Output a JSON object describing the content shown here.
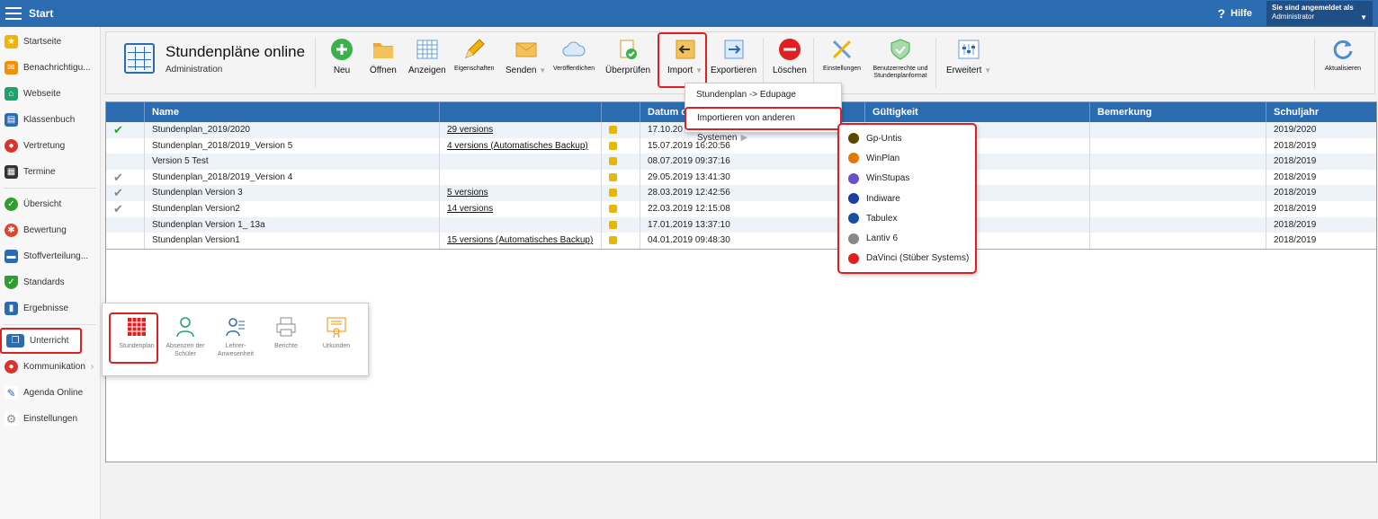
{
  "topbar": {
    "start_label": "Start",
    "help_label": "Hilfe",
    "help_icon": "?",
    "user_line1": "Sie sind angemeldet als",
    "user_line2": "Administrator"
  },
  "sidebar": {
    "items": [
      {
        "label": "Startseite",
        "icon": "star-icon",
        "color": "#f2b400"
      },
      {
        "label": "Benachrichtigu...",
        "icon": "envelope-icon",
        "color": "#f29000"
      },
      {
        "label": "Webseite",
        "icon": "home-icon",
        "color": "#1aa36b"
      },
      {
        "label": "Klassenbuch",
        "icon": "book-icon",
        "color": "#2b6cb0"
      },
      {
        "label": "Vertretung",
        "icon": "person-icon",
        "color": "#d9342b"
      },
      {
        "label": "Termine",
        "icon": "calendar-icon",
        "color": "#333333"
      },
      {
        "label": "Übersicht",
        "icon": "check-circle-icon",
        "color": "#2e9e2e"
      },
      {
        "label": "Bewertung",
        "icon": "rating-icon",
        "color": "#e0452b"
      },
      {
        "label": "Stoffverteilung...",
        "icon": "plan-icon",
        "color": "#2b6cb0"
      },
      {
        "label": "Standards",
        "icon": "shield-icon",
        "color": "#2e9e2e"
      },
      {
        "label": "Ergebnisse",
        "icon": "bar-chart-icon",
        "color": "#2b6cb0"
      },
      {
        "label": "Unterricht",
        "icon": "open-book-icon",
        "color": "#2b6cb0"
      },
      {
        "label": "Kommunikation",
        "icon": "chat-icon",
        "color": "#d9342b"
      },
      {
        "label": "Agenda Online",
        "icon": "pen-icon",
        "color": "#2b6cb0"
      },
      {
        "label": "Einstellungen",
        "icon": "gear-icon",
        "color": "#888888"
      }
    ],
    "submenu_arrow": "›"
  },
  "toolbar": {
    "title": "Stundenpläne online",
    "subtitle": "Administration",
    "buttons": {
      "neu": "Neu",
      "oeffnen": "Öffnen",
      "anzeigen": "Anzeigen",
      "eigenschaften": "Eigenschaften",
      "senden": "Senden",
      "veroeffentlichen": "Veröffentlichen",
      "ueberpruefen": "Überprüfen",
      "import": "Import",
      "exportieren": "Exportieren",
      "loeschen": "Löschen",
      "einstellungen": "Einstellungen",
      "benutzerrechte": "Benutzerrechte und Stundenplanformat",
      "erweitert": "Erweitert",
      "aktualisieren": "Aktualisieren"
    },
    "dropdown_caret": "▼"
  },
  "table": {
    "headers": [
      "",
      "Name",
      "",
      "",
      "Datum d",
      "Gültigkeit",
      "Bemerkung",
      "Schuljahr"
    ],
    "rows": [
      {
        "check": "✔",
        "check_style": "green",
        "name": "Stundenplan_2019/2020",
        "versions": "29 versions",
        "date": "17.10.20",
        "year": "2019/2020"
      },
      {
        "check": "",
        "check_style": "",
        "name": "Stundenplan_2018/2019_Version 5",
        "versions": "4 versions (Automatisches Backup)",
        "date": "15.07.2019 16:20:56",
        "year": "2018/2019"
      },
      {
        "check": "",
        "check_style": "",
        "name": "Version 5 Test",
        "versions": "",
        "date": "08.07.2019 09:37:16",
        "year": "2018/2019"
      },
      {
        "check": "✔",
        "check_style": "grey",
        "name": "Stundenplan_2018/2019_Version 4",
        "versions": "",
        "date": "29.05.2019 13:41:30",
        "year": "2018/2019"
      },
      {
        "check": "✔",
        "check_style": "grey",
        "name": "Stundenplan Version 3",
        "versions": "5 versions",
        "date": "28.03.2019 12:42:56",
        "year": "2018/2019"
      },
      {
        "check": "✔",
        "check_style": "grey",
        "name": "Stundenplan Version2",
        "versions": "14 versions",
        "date": "22.03.2019 12:15:08",
        "year": "2018/2019"
      },
      {
        "check": "",
        "check_style": "",
        "name": "Stundenplan Version 1_ 13a",
        "versions": "",
        "date": "17.01.2019 13:37:10",
        "year": "2018/2019"
      },
      {
        "check": "",
        "check_style": "",
        "name": "Stundenplan Version1",
        "versions": "15 versions (Automatisches Backup)",
        "date": "04.01.2019 09:48:30",
        "year": "2018/2019"
      }
    ]
  },
  "import_menu": {
    "items": [
      "Stundenplan -> Edupage",
      "Importieren von anderen Systemen"
    ],
    "submenu_arrow": "▶"
  },
  "systems_menu": {
    "items": [
      {
        "label": "Gp-Untis",
        "color": "#5a4a00"
      },
      {
        "label": "WinPlan",
        "color": "#e07b00"
      },
      {
        "label": "WinStupas",
        "color": "#6a4fc7"
      },
      {
        "label": "Indiware",
        "color": "#1a3fa0"
      },
      {
        "label": "Tabulex",
        "color": "#1a4fa0"
      },
      {
        "label": "Lantiv 6",
        "color": "#888888"
      },
      {
        "label": "DaVinci (Stüber Systems)",
        "color": "#e02020"
      }
    ]
  },
  "unterricht_popup": {
    "items": [
      "Stundenplan",
      "Absenzen der Schüler",
      "Lehrer-Anwesenheit",
      "Berichte",
      "Urkunden"
    ]
  },
  "colors": {
    "accent": "#2b6cb0",
    "highlight": "#e02020"
  }
}
